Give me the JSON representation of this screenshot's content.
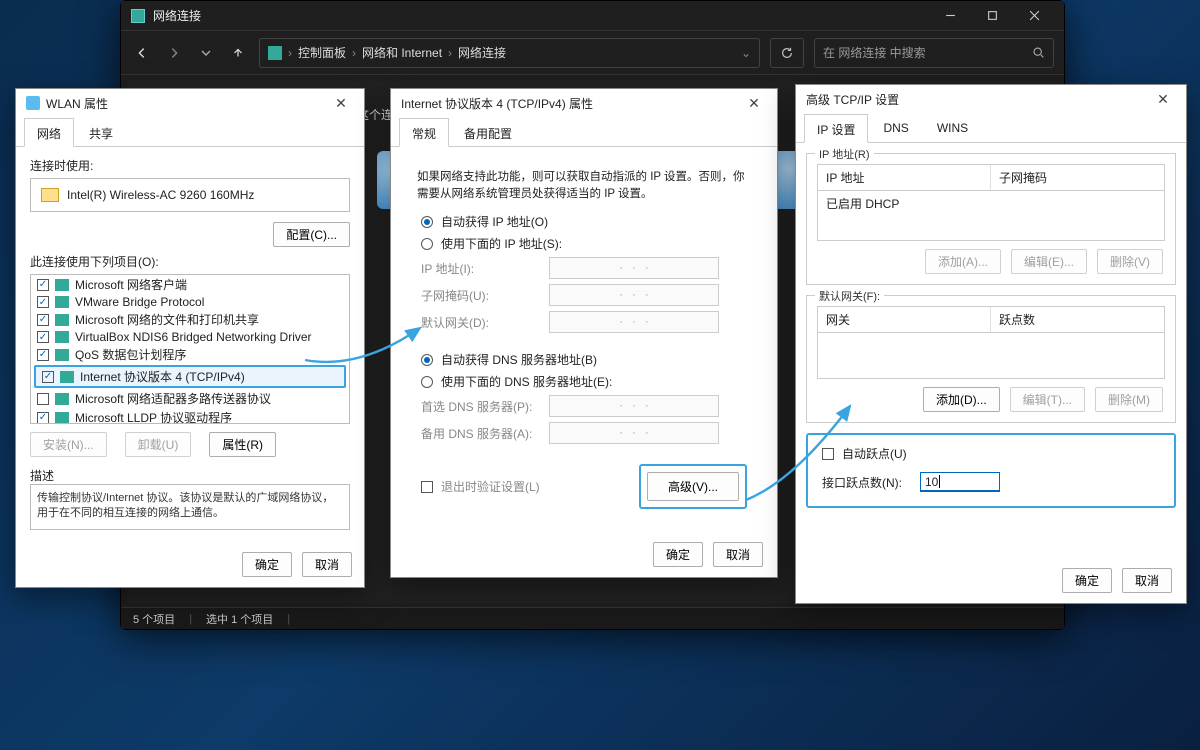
{
  "explorer": {
    "title": "网络连接",
    "breadcrumb": [
      "控制面板",
      "网络和 Internet",
      "网络连接"
    ],
    "search_placeholder": "在 网络连接 中搜索",
    "status_left": "5 个项目",
    "status_sel": "选中 1 个项目"
  },
  "wlan": {
    "title": "WLAN 属性",
    "tabs": [
      "网络",
      "共享"
    ],
    "connect_using_label": "连接时使用:",
    "adapter": "Intel(R) Wireless-AC 9260 160MHz",
    "configure_btn": "配置(C)...",
    "items_label": "此连接使用下列项目(O):",
    "items": [
      {
        "checked": true,
        "label": "Microsoft 网络客户端"
      },
      {
        "checked": true,
        "label": "VMware Bridge Protocol"
      },
      {
        "checked": true,
        "label": "Microsoft 网络的文件和打印机共享"
      },
      {
        "checked": true,
        "label": "VirtualBox NDIS6 Bridged Networking Driver"
      },
      {
        "checked": true,
        "label": "QoS 数据包计划程序"
      },
      {
        "checked": true,
        "label": "Internet 协议版本 4 (TCP/IPv4)",
        "highlight": true
      },
      {
        "checked": false,
        "label": "Microsoft 网络适配器多路传送器协议"
      },
      {
        "checked": true,
        "label": "Microsoft LLDP 协议驱动程序"
      }
    ],
    "install_btn": "安装(N)...",
    "uninstall_btn": "卸载(U)",
    "props_btn": "属性(R)",
    "desc_label": "描述",
    "desc_text": "传输控制协议/Internet 协议。该协议是默认的广域网络协议，用于在不同的相互连接的网络上通信。",
    "ok": "确定",
    "cancel": "取消"
  },
  "ipv4": {
    "title": "Internet 协议版本 4 (TCP/IPv4) 属性",
    "tabs": [
      "常规",
      "备用配置"
    ],
    "intro": "如果网络支持此功能，则可以获取自动指派的 IP 设置。否则，你需要从网络系统管理员处获得适当的 IP 设置。",
    "radio_auto_ip": "自动获得 IP 地址(O)",
    "radio_static_ip": "使用下面的 IP 地址(S):",
    "ip_label": "IP 地址(I):",
    "mask_label": "子网掩码(U):",
    "gw_label": "默认网关(D):",
    "radio_auto_dns": "自动获得 DNS 服务器地址(B)",
    "radio_static_dns": "使用下面的 DNS 服务器地址(E):",
    "dns1_label": "首选 DNS 服务器(P):",
    "dns2_label": "备用 DNS 服务器(A):",
    "validate_cb": "退出时验证设置(L)",
    "advanced_btn": "高级(V)...",
    "ok": "确定",
    "cancel": "取消"
  },
  "adv": {
    "title": "高级 TCP/IP 设置",
    "tabs": [
      "IP 设置",
      "DNS",
      "WINS"
    ],
    "ip_group": "IP 地址(R)",
    "ip_col1": "IP 地址",
    "ip_col2": "子网掩码",
    "ip_row": "已启用 DHCP",
    "gw_group": "默认网关(F):",
    "gw_col1": "网关",
    "gw_col2": "跃点数",
    "add_a": "添加(A)...",
    "edit_e": "编辑(E)...",
    "del_v": "删除(V)",
    "add_d": "添加(D)...",
    "edit_t": "编辑(T)...",
    "del_m": "删除(M)",
    "auto_hop_cb": "自动跃点(U)",
    "hop_label": "接口跃点数(N):",
    "hop_value": "10",
    "ok": "确定",
    "cancel": "取消"
  }
}
